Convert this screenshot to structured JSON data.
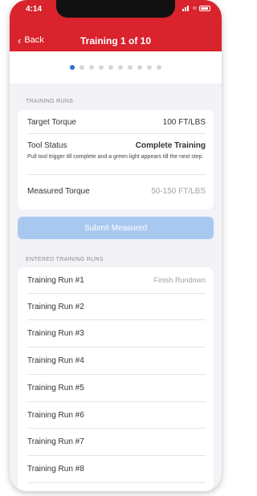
{
  "status_bar": {
    "time": "4:14"
  },
  "nav": {
    "back_label": "Back",
    "title": "Training 1 of 10"
  },
  "pager": {
    "total": 10,
    "current": 1
  },
  "training_runs": {
    "section_label": "TRAINING RUNS",
    "target_torque_label": "Target Torque",
    "target_torque_value": "100 FT/LBS",
    "tool_status_label": "Tool Status",
    "tool_status_value": "Complete Training",
    "instructions": "Pull tool trigger till complete and a green light appears till the next step.",
    "measured_torque_label": "Measured Torque",
    "measured_torque_placeholder": "50-150 FT/LBS"
  },
  "submit_label": "Submit Measured",
  "entered": {
    "section_label": "ENTERED TRAINING RUNS",
    "runs": [
      {
        "label": "Training Run #1",
        "status": "Finish Rundown"
      },
      {
        "label": "Training Run #2",
        "status": ""
      },
      {
        "label": "Training Run #3",
        "status": ""
      },
      {
        "label": "Training Run #4",
        "status": ""
      },
      {
        "label": "Training Run #5",
        "status": ""
      },
      {
        "label": "Training Run #6",
        "status": ""
      },
      {
        "label": "Training Run #7",
        "status": ""
      },
      {
        "label": "Training Run #8",
        "status": ""
      }
    ]
  },
  "colors": {
    "header": "#d9232d",
    "accent": "#2f6fd6",
    "submit_disabled": "#a9c8f0"
  }
}
